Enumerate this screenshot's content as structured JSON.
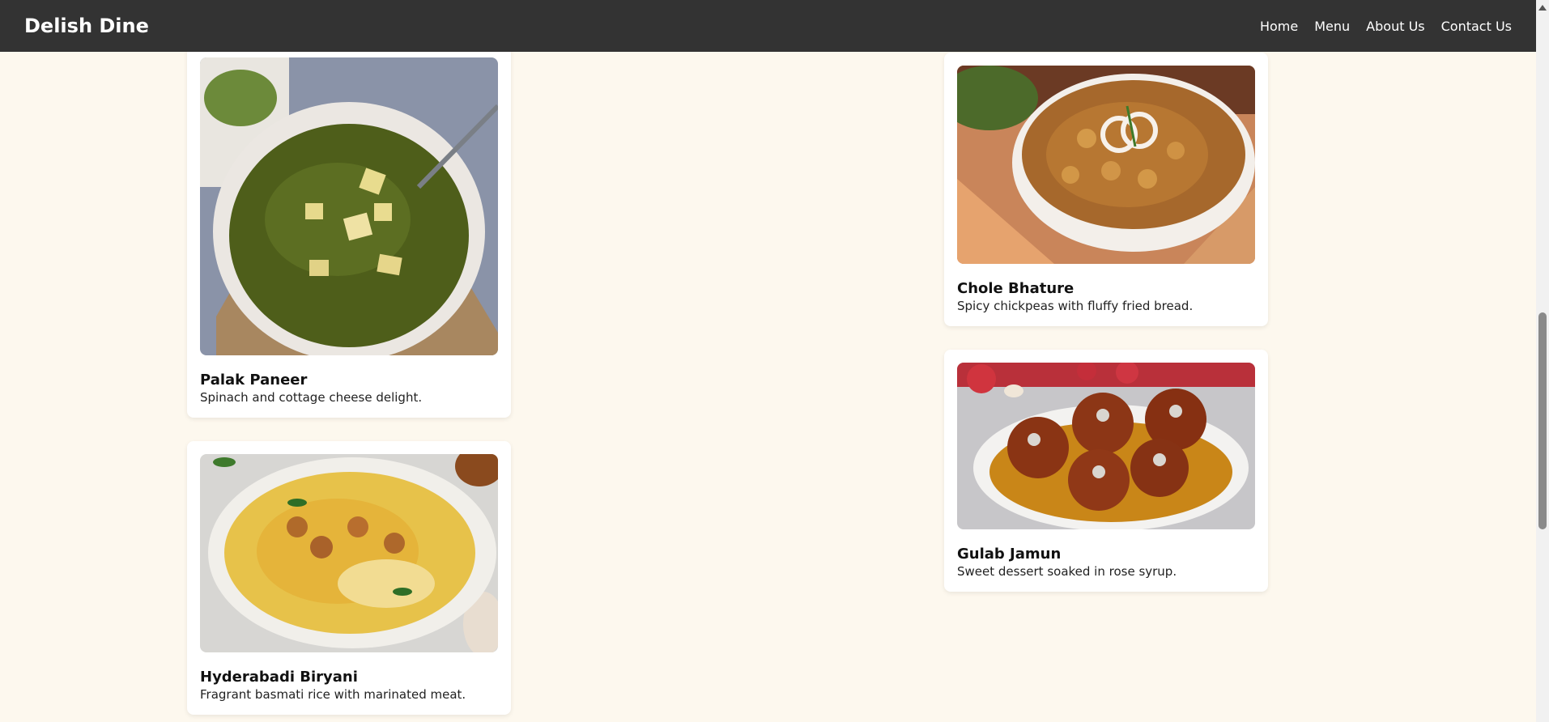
{
  "nav": {
    "brand": "Delish Dine",
    "links": [
      "Home",
      "Menu",
      "About Us",
      "Contact Us"
    ]
  },
  "dishes": [
    {
      "name": "Palak Paneer",
      "description": "Spinach and cottage cheese delight."
    },
    {
      "name": "Chole Bhature",
      "description": "Spicy chickpeas with fluffy fried bread."
    },
    {
      "name": "Hyderabadi Biryani",
      "description": "Fragrant basmati rice with marinated meat."
    },
    {
      "name": "Gulab Jamun",
      "description": "Sweet dessert soaked in rose syrup."
    }
  ],
  "colors": {
    "navbar": "#333333",
    "page_background": "#fdf8ee",
    "card_background": "#ffffff"
  }
}
